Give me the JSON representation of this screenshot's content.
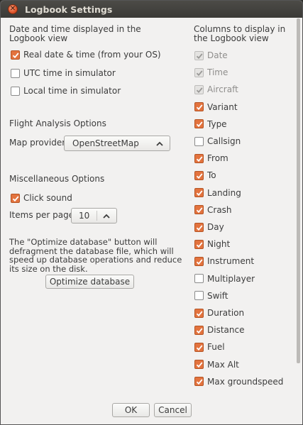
{
  "window": {
    "title": "Logbook Settings"
  },
  "date_section": {
    "heading": "Date and time displayed in the Logbook view",
    "options": [
      {
        "label": "Real date & time (from your OS)",
        "checked": true
      },
      {
        "label": "UTC time in simulator",
        "checked": false
      },
      {
        "label": "Local time in simulator",
        "checked": false
      }
    ]
  },
  "flight_section": {
    "heading": "Flight Analysis Options",
    "map_provider_label": "Map provider",
    "map_provider_value": "OpenStreetMap"
  },
  "misc_section": {
    "heading": "Miscellaneous Options",
    "click_sound_label": "Click sound",
    "click_sound_checked": true,
    "items_per_page_label": "Items per page",
    "items_per_page_value": "10",
    "optimize_description": "The \"Optimize database\" button will defragment the database file, which will speed up database operations and reduce its size on the disk.",
    "optimize_button": "Optimize database"
  },
  "columns_section": {
    "heading": "Columns to display in the Logbook view",
    "items": [
      {
        "label": "Date",
        "checked": true,
        "disabled": true
      },
      {
        "label": "Time",
        "checked": true,
        "disabled": true
      },
      {
        "label": "Aircraft",
        "checked": true,
        "disabled": true
      },
      {
        "label": "Variant",
        "checked": true,
        "disabled": false
      },
      {
        "label": "Type",
        "checked": true,
        "disabled": false
      },
      {
        "label": "Callsign",
        "checked": false,
        "disabled": false
      },
      {
        "label": "From",
        "checked": true,
        "disabled": false
      },
      {
        "label": "To",
        "checked": true,
        "disabled": false
      },
      {
        "label": "Landing",
        "checked": true,
        "disabled": false
      },
      {
        "label": "Crash",
        "checked": true,
        "disabled": false
      },
      {
        "label": "Day",
        "checked": true,
        "disabled": false
      },
      {
        "label": "Night",
        "checked": true,
        "disabled": false
      },
      {
        "label": "Instrument",
        "checked": true,
        "disabled": false
      },
      {
        "label": "Multiplayer",
        "checked": false,
        "disabled": false
      },
      {
        "label": "Swift",
        "checked": false,
        "disabled": false
      },
      {
        "label": "Duration",
        "checked": true,
        "disabled": false
      },
      {
        "label": "Distance",
        "checked": true,
        "disabled": false
      },
      {
        "label": "Fuel",
        "checked": true,
        "disabled": false
      },
      {
        "label": "Max Alt",
        "checked": true,
        "disabled": false
      },
      {
        "label": "Max groundspeed",
        "checked": true,
        "disabled": false
      }
    ]
  },
  "buttons": {
    "ok": "OK",
    "cancel": "Cancel"
  },
  "colors": {
    "accent": "#e3733e",
    "titlebar": "#3c3b37",
    "window_bg": "#f2f1f0"
  }
}
